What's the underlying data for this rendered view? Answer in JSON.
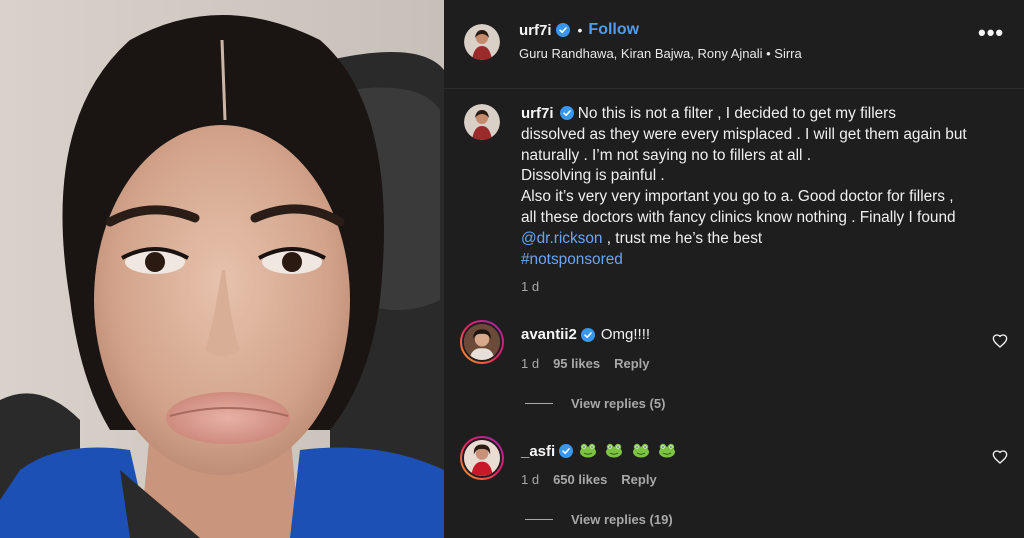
{
  "post": {
    "author": "urf7i",
    "follow_label": "Follow",
    "separator": "•",
    "collaborators": "Guru Randhawa, Kiran Bajwa, Rony Ajnali • Sirra",
    "more_icon": "more-options-icon",
    "more_label": "•••"
  },
  "caption": {
    "author": "urf7i",
    "line1": "No this is not a filter , I decided to get my fillers",
    "line2": "dissolved as they were every misplaced . I will get them again but",
    "line3": "naturally . I’m not saying no to fillers at all .",
    "line4": "Dissolving is painful .",
    "line5": "Also it’s very very important you go to a. Good doctor for fillers ,",
    "line6": "all these doctors with fancy clinics know nothing . Finally I found",
    "mention": "@dr.rickson",
    "line7_rest": " , trust me he’s the best",
    "hashtag": "#notsponsored",
    "time": "1 d"
  },
  "comments": [
    {
      "username": "avantii2",
      "text": "Omg!!!!",
      "time": "1 d",
      "likes": "95 likes",
      "reply_label": "Reply",
      "view_replies": "View replies (5)"
    },
    {
      "username": "_asfi",
      "text": "",
      "emoji_icons": [
        "frog-emoji-icon",
        "frog-emoji-icon",
        "frog-emoji-icon",
        "frog-emoji-icon"
      ],
      "time": "1 d",
      "likes": "650 likes",
      "reply_label": "Reply",
      "view_replies": "View replies (19)"
    }
  ],
  "colors": {
    "background": "#1e1e1e",
    "link": "#4f9cf0",
    "verified": "#3897f0",
    "muted": "#a8a8a8"
  }
}
